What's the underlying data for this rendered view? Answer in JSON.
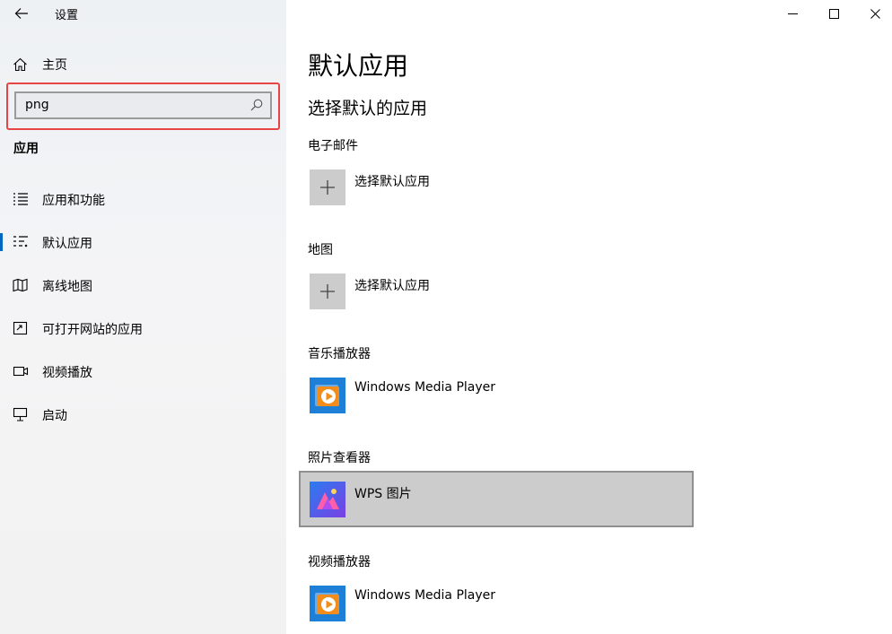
{
  "window": {
    "title": "设置"
  },
  "sidebar": {
    "home_label": "主页",
    "search_value": "png",
    "section_title": "应用",
    "items": [
      {
        "label": "应用和功能",
        "icon": "apps-features-icon",
        "selected": false
      },
      {
        "label": "默认应用",
        "icon": "default-apps-icon",
        "selected": true
      },
      {
        "label": "离线地图",
        "icon": "offline-maps-icon",
        "selected": false
      },
      {
        "label": "可打开网站的应用",
        "icon": "apps-for-websites-icon",
        "selected": false
      },
      {
        "label": "视频播放",
        "icon": "video-playback-icon",
        "selected": false
      },
      {
        "label": "启动",
        "icon": "startup-icon",
        "selected": false
      }
    ]
  },
  "main": {
    "title": "默认应用",
    "subtitle": "选择默认的应用",
    "categories": [
      {
        "label": "电子邮件",
        "app": "选择默认应用",
        "icon": "plus-icon"
      },
      {
        "label": "地图",
        "app": "选择默认应用",
        "icon": "plus-icon"
      },
      {
        "label": "音乐播放器",
        "app": "Windows Media Player",
        "icon": "windows-media-player-icon"
      },
      {
        "label": "照片查看器",
        "app": "WPS 图片",
        "icon": "wps-pictures-icon",
        "highlighted": true
      },
      {
        "label": "视频播放器",
        "app": "Windows Media Player",
        "icon": "windows-media-player-icon"
      }
    ]
  },
  "colors": {
    "accent": "#0067c0",
    "search_highlight": "#e74545",
    "selected_bg": "#cccccc"
  }
}
